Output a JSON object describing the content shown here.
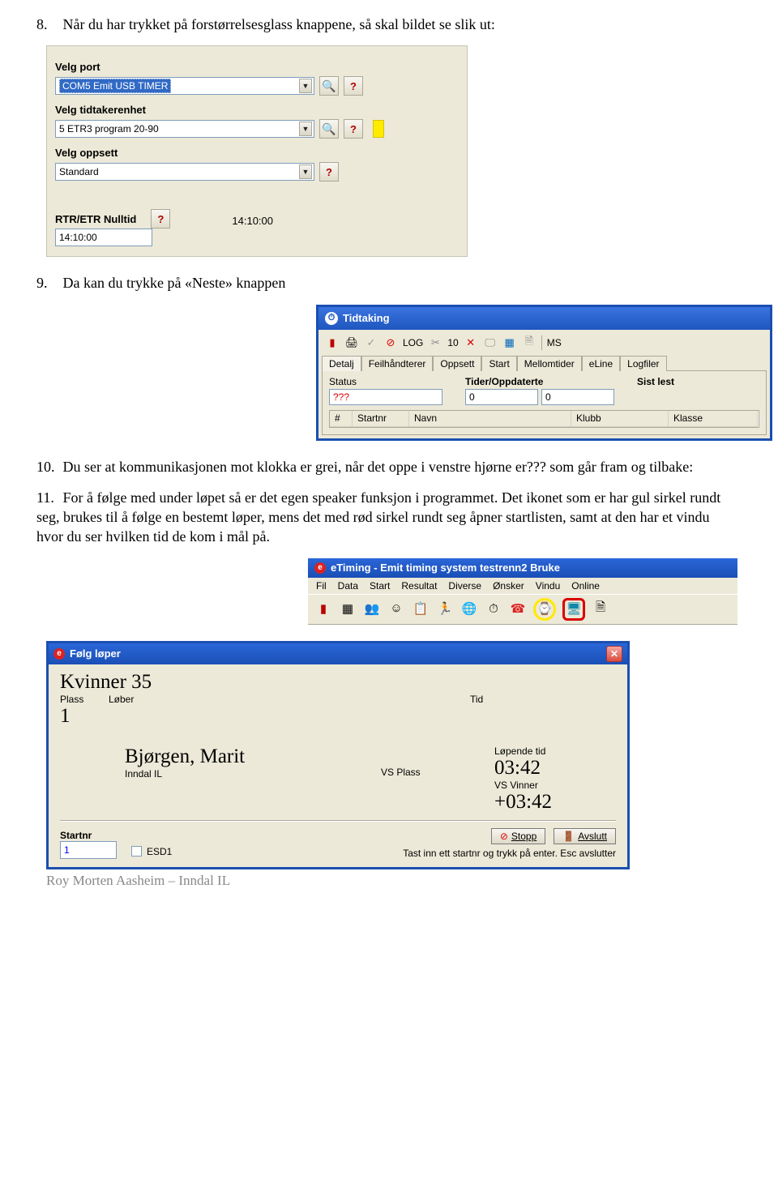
{
  "doc": {
    "p8_num": "8.",
    "p8": "Når du har trykket på forstørrelsesglass knappene, så skal bildet se slik ut:",
    "p9_num": "9.",
    "p9": "Da kan du trykke på «Neste» knappen",
    "p10_num": "10.",
    "p10": "Du ser at kommunikasjonen mot klokka er grei, når det oppe i venstre hjørne er??? som går fram og tilbake:",
    "p11_num": "11.",
    "p11": "For å følge med under løpet så er det egen speaker funksjon i programmet. Det ikonet som er har gul sirkel rundt seg, brukes til å følge en bestemt løper, mens det med rød sirkel rundt seg åpner startlisten, samt at den har et vindu hvor du ser hvilken tid de kom i mål på.",
    "footer_cut": "Roy Morten Aasheim – Inndal IL"
  },
  "cfg": {
    "velg_port": "Velg port",
    "port_value": "COM5 Emit USB TIMER",
    "velg_tid": "Velg tidtakerenhet",
    "tid_value": "5 ETR3 program 20-90",
    "velg_opp": "Velg oppsett",
    "opp_value": "Standard",
    "nulltid_lbl": "RTR/ETR Nulltid",
    "nulltid_val": "14:10:00",
    "clock_display": "14:10:00"
  },
  "tidtak": {
    "title": "Tidtaking",
    "log_label": "LOG",
    "count": "10",
    "ms": "MS",
    "tabs": [
      "Detalj",
      "Feilhåndterer",
      "Oppsett",
      "Start",
      "Mellomtider",
      "eLine",
      "Logfiler"
    ],
    "status_lbl": "Status",
    "status_val": "???",
    "tider_lbl": "Tider/Oppdaterte",
    "tider_v1": "0",
    "tider_v2": "0",
    "sist_lbl": "Sist lest",
    "cols": [
      "#",
      "Startnr",
      "Navn",
      "Klubb",
      "Klasse"
    ]
  },
  "etiming": {
    "title": "eTiming - Emit timing system  testrenn2   Bruke",
    "menus": [
      "Fil",
      "Data",
      "Start",
      "Resultat",
      "Diverse",
      "Ønsker",
      "Vindu",
      "Online"
    ]
  },
  "folg": {
    "title": "Følg løper",
    "klasse": "Kvinner 35",
    "h_plass": "Plass",
    "h_lober": "Løber",
    "h_tid": "Tid",
    "plass_val": "1",
    "navn": "Bjørgen, Marit",
    "klubb": "Inndal IL",
    "vs_plass": "VS Plass",
    "lopende_lbl": "Løpende tid",
    "lopende_val": "03:42",
    "vs_vinner": "VS Vinner",
    "vs_val": "+03:42",
    "startnr_lbl": "Startnr",
    "startnr_val": "1",
    "esd1": "ESD1",
    "stopp": "Stopp",
    "avslutt": "Avslutt",
    "hint": "Tast inn ett startnr og trykk på enter. Esc avslutter"
  }
}
